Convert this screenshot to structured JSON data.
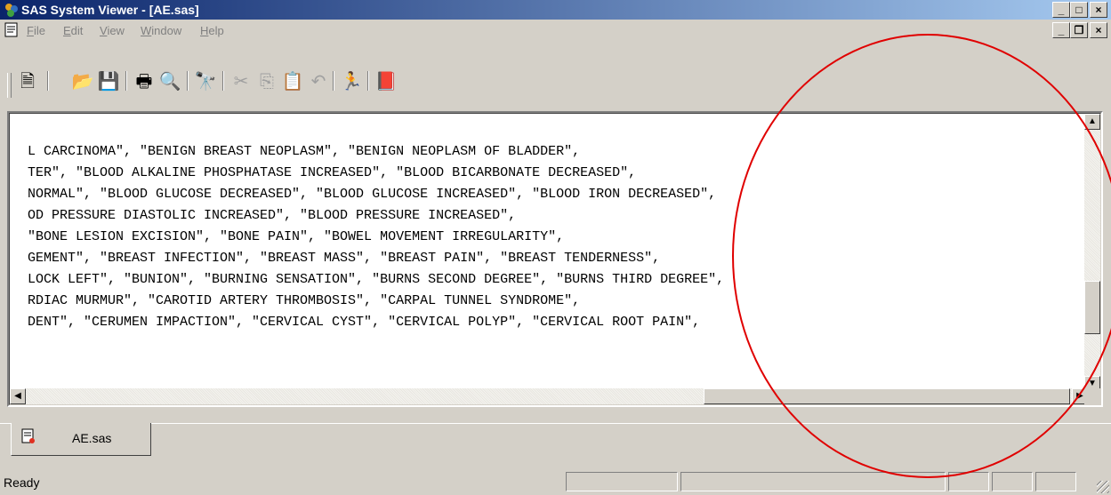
{
  "window": {
    "title": "SAS System Viewer - [AE.sas]"
  },
  "menu": [
    {
      "label": "File",
      "u": "F",
      "rest": "ile"
    },
    {
      "label": "Edit",
      "u": "E",
      "rest": "dit"
    },
    {
      "label": "View",
      "u": "V",
      "rest": "iew"
    },
    {
      "label": "Window",
      "u": "W",
      "rest": "indow"
    },
    {
      "label": "Help",
      "u": "H",
      "rest": "elp"
    }
  ],
  "editor": {
    "lines": [
      "L CARCINOMA\", \"BENIGN BREAST NEOPLASM\", \"BENIGN NEOPLASM OF BLADDER\",",
      "TER\", \"BLOOD ALKALINE PHOSPHATASE INCREASED\", \"BLOOD BICARBONATE DECREASED\",",
      "NORMAL\", \"BLOOD GLUCOSE DECREASED\", \"BLOOD GLUCOSE INCREASED\", \"BLOOD IRON DECREASED\",",
      "OD PRESSURE DIASTOLIC INCREASED\", \"BLOOD PRESSURE INCREASED\",",
      "\"BONE LESION EXCISION\", \"BONE PAIN\", \"BOWEL MOVEMENT IRREGULARITY\",",
      "GEMENT\", \"BREAST INFECTION\", \"BREAST MASS\", \"BREAST PAIN\", \"BREAST TENDERNESS\",",
      "LOCK LEFT\", \"BUNION\", \"BURNING SENSATION\", \"BURNS SECOND DEGREE\", \"BURNS THIRD DEGREE\",",
      "RDIAC MURMUR\", \"CAROTID ARTERY THROMBOSIS\", \"CARPAL TUNNEL SYNDROME\",",
      "DENT\", \"CERUMEN IMPACTION\", \"CERVICAL CYST\", \"CERVICAL POLYP\", \"CERVICAL ROOT PAIN\","
    ]
  },
  "tabs": [
    {
      "label": "AE.sas"
    }
  ],
  "status": {
    "text": "Ready"
  },
  "annotation": {
    "color": "#e00000"
  }
}
